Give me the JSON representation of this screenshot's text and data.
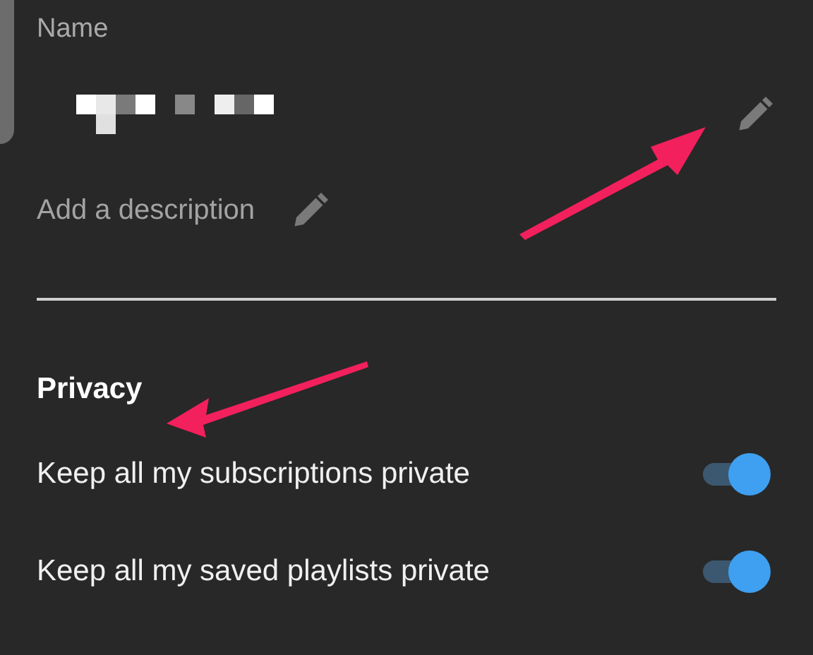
{
  "name_field": {
    "label": "Name"
  },
  "description_field": {
    "placeholder": "Add a description"
  },
  "privacy": {
    "title": "Privacy",
    "settings": [
      {
        "label": "Keep all my subscriptions private",
        "on": true
      },
      {
        "label": "Keep all my saved playlists private",
        "on": true
      }
    ]
  }
}
